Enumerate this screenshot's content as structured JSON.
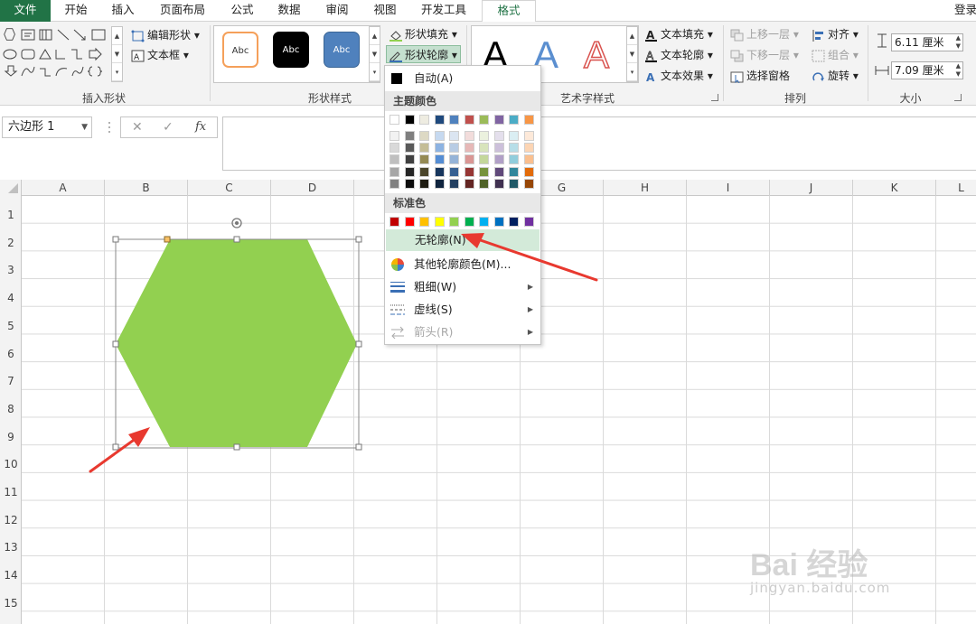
{
  "tabs": {
    "file": "文件",
    "home": "开始",
    "insert": "插入",
    "page_layout": "页面布局",
    "formulas": "公式",
    "data": "数据",
    "review": "审阅",
    "view": "视图",
    "developer": "开发工具",
    "format": "格式",
    "login": "登录"
  },
  "ribbon": {
    "insert_shapes": {
      "edit_shape": "编辑形状",
      "text_box": "文本框",
      "label": "插入形状"
    },
    "shape_styles": {
      "style_sample": "Abc",
      "shape_fill": "形状填充",
      "shape_outline": "形状轮廓",
      "label": "形状样式"
    },
    "wordart": {
      "letter": "A",
      "text_fill": "文本填充",
      "text_outline": "文本轮廓",
      "text_effects": "文本效果",
      "label": "艺术字样式"
    },
    "arrange": {
      "bring_forward": "上移一层",
      "send_backward": "下移一层",
      "selection_pane": "选择窗格",
      "align": "对齐",
      "group": "组合",
      "rotate": "旋转",
      "label": "排列"
    },
    "size": {
      "height": "6.11 厘米",
      "width": "7.09 厘米",
      "label": "大小"
    }
  },
  "formula_bar": {
    "name_box": "六边形 1",
    "cancel": "✕",
    "enter": "✓",
    "fx": "fx",
    "formula": ""
  },
  "columns": [
    "A",
    "B",
    "C",
    "D",
    "E",
    "F",
    "G",
    "H",
    "I",
    "J",
    "K",
    "L"
  ],
  "rows": [
    "1",
    "2",
    "3",
    "4",
    "5",
    "6",
    "7",
    "8",
    "9",
    "10",
    "11",
    "12",
    "13",
    "14",
    "15"
  ],
  "shape": {
    "type": "hexagon",
    "fill": "#92D050"
  },
  "outline_menu": {
    "auto": "自动(A)",
    "theme_colors_header": "主题颜色",
    "standard_colors_header": "标准色",
    "no_outline": "无轮廓(N)",
    "more_colors": "其他轮廓颜色(M)...",
    "weight": "粗细(W)",
    "dashes": "虚线(S)",
    "arrows": "箭头(R)"
  },
  "theme_colors": [
    "#FFFFFF",
    "#000000",
    "#EEECE1",
    "#1F497D",
    "#4F81BD",
    "#C0504D",
    "#9BBB59",
    "#8064A2",
    "#4BACC6",
    "#F79646"
  ],
  "theme_shades": [
    [
      "#F2F2F2",
      "#D9D9D9",
      "#BFBFBF",
      "#A6A6A6",
      "#808080"
    ],
    [
      "#7F7F7F",
      "#595959",
      "#404040",
      "#262626",
      "#0D0D0D"
    ],
    [
      "#DDD9C4",
      "#C4BD97",
      "#948A54",
      "#4A452A",
      "#1E1C11"
    ],
    [
      "#C6D9F0",
      "#8DB3E2",
      "#548DD4",
      "#17365D",
      "#0F243E"
    ],
    [
      "#DBE5F1",
      "#B8CCE4",
      "#95B3D7",
      "#366092",
      "#244061"
    ],
    [
      "#F2DCDB",
      "#E6B8B7",
      "#DA9694",
      "#963634",
      "#632523"
    ],
    [
      "#EBF1DE",
      "#D8E4BC",
      "#C4D79B",
      "#76933C",
      "#4F6228"
    ],
    [
      "#E4DFEC",
      "#CCC0DA",
      "#B1A0C7",
      "#60497A",
      "#403151"
    ],
    [
      "#DAEEF3",
      "#B7DEE8",
      "#92CDDC",
      "#31869B",
      "#215967"
    ],
    [
      "#FDE9D9",
      "#FCD5B4",
      "#FABF8F",
      "#E26B0A",
      "#974706"
    ]
  ],
  "standard_colors": [
    "#C00000",
    "#FF0000",
    "#FFC000",
    "#FFFF00",
    "#92D050",
    "#00B050",
    "#00B0F0",
    "#0070C0",
    "#002060",
    "#7030A0"
  ],
  "accent_color": "#217346",
  "annotation_color": "#E8392F",
  "watermark": {
    "brand": "Bai 经验",
    "url": "jingyan.baidu.com"
  }
}
